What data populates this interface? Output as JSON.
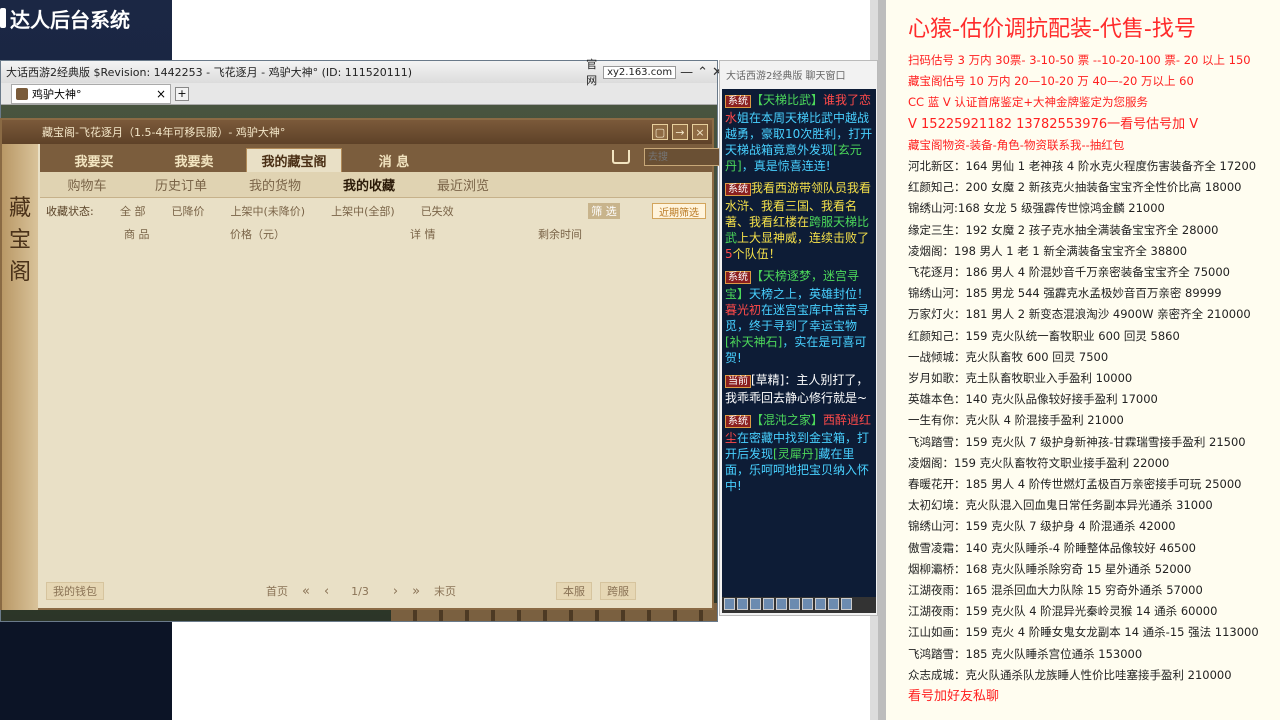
{
  "admin": {
    "title": "达人后台系统"
  },
  "game_window": {
    "title": "大话西游2经典版 $Revision: 1442253 - 飞花逐月 - 鸡驴大神° (ID: 111520111)",
    "official": "官网",
    "site": "xy2.163.com",
    "tab_label": "鸡驴大神°",
    "tab_close": "×",
    "tab_add": "+",
    "btn_min": "—",
    "btn_up": "⌃",
    "btn_close": "✕"
  },
  "dialog": {
    "title": "藏宝阁-飞花逐月（1.5-4年可移民服）- 鸡驴大神°",
    "side_chars": [
      "藏",
      "宝",
      "阁"
    ],
    "main_tabs": [
      "我要买",
      "我要卖",
      "我的藏宝阁",
      "消 息"
    ],
    "search_placeholder": "去搜",
    "sub_tabs": [
      "购物车",
      "历史订单",
      "我的货物",
      "我的收藏",
      "最近浏览"
    ],
    "filter_label": "收藏状态:",
    "filter_opts": [
      "全 部",
      "已降价",
      "上架中(未降价)",
      "上架中(全部)",
      "已失效"
    ],
    "filter_btn": "筛 选",
    "recent_btn": "近期筛选",
    "columns": [
      "商 品",
      "价格（元）",
      "详 情",
      "剩余时间"
    ],
    "footer": {
      "wallet": "我的钱包",
      "first": "首页",
      "page": "1/3",
      "last": "末页",
      "this_server": "本服",
      "cross_server": "跨服"
    }
  },
  "chat": {
    "title": "大话西游2经典版 聊天窗口",
    "messages": [
      {
        "tag": "系统",
        "parts": [
          [
            "c-green",
            "【天梯比武】"
          ],
          [
            "c-red",
            "谁我了恋水"
          ],
          [
            "c-cyan",
            "姐在本周天梯比武中越战越勇，豪取10次胜利，打开天梯战箱竟意外发现"
          ],
          [
            "c-green",
            "[玄元丹]"
          ],
          [
            "c-cyan",
            "，真是惊喜连连!"
          ]
        ]
      },
      {
        "tag": "系统",
        "parts": [
          [
            "c-yellow",
            "我看西游带领队员我看水浒、我看三国、我看名著、我看红楼在"
          ],
          [
            "c-green",
            "跨服天梯比武"
          ],
          [
            "c-yellow",
            "上大显神威，连续击败了"
          ],
          [
            "c-red",
            "5"
          ],
          [
            "c-yellow",
            "个队伍！"
          ]
        ]
      },
      {
        "tag": "系统",
        "parts": [
          [
            "c-green",
            "【天榜逐梦，迷宫寻宝】"
          ],
          [
            "c-cyan",
            "天榜之上，英雄封位！"
          ],
          [
            "c-red",
            "暮光初"
          ],
          [
            "c-cyan",
            "在迷宫宝库中苦苦寻觅，终于寻到了幸运宝物"
          ],
          [
            "c-green",
            "[补天神石]"
          ],
          [
            "c-cyan",
            "，实在是可喜可贺!"
          ]
        ]
      },
      {
        "tag": "当前",
        "parts": [
          [
            "",
            "[草精]："
          ],
          [
            "",
            "主人别打了，我乖乖回去静心修行就是~"
          ]
        ]
      },
      {
        "tag": "系统",
        "parts": [
          [
            "c-green",
            "【混沌之家】"
          ],
          [
            "c-red",
            "西醉逍红尘"
          ],
          [
            "c-cyan",
            "在密藏中找到金宝箱，打开后发现"
          ],
          [
            "c-green",
            "[灵犀丹]"
          ],
          [
            "c-cyan",
            "藏在里面，乐呵呵地把宝贝纳入怀中!"
          ]
        ]
      }
    ]
  },
  "info": {
    "headline": "心猿-估价调抗配装-代售-找号",
    "lines": [
      {
        "cls": "red",
        "text": "扫码估号 3 万内 30票- 3-10-50 票 --10-20-100 票- 20 以上 150"
      },
      {
        "cls": "red",
        "text": "藏宝阁估号 10 万内 20—10-20 万 40—-20 万以上 60"
      },
      {
        "cls": "red",
        "text": "CC 蓝 V 认证首席鉴定+大神金牌鉴定为您服务"
      },
      {
        "cls": "red big",
        "text": "V 15225921182    13782553976一看号估号加 V"
      },
      {
        "cls": "red",
        "text": "藏宝阁物资-装备-角色-物资联系我--抽红包"
      },
      {
        "cls": "",
        "text": "河北新区：164 男仙 1 老神孩 4 阶水克火程度伤害装备齐全 17200"
      },
      {
        "cls": "",
        "text": "红颜知己：200 女魔 2 新孩克火抽装备宝宝齐全性价比高 18000"
      },
      {
        "cls": "",
        "text": "锦绣山河:168 女龙 5 级强霹传世惊鸿金麟 21000"
      },
      {
        "cls": "",
        "text": "缘定三生：192 女魔 2 孩子克水抽全满装备宝宝齐全 28000"
      },
      {
        "cls": "",
        "text": "凌烟阁：198 男人 1 老 1 新全满装备宝宝齐全 38800"
      },
      {
        "cls": "",
        "text": "飞花逐月：186 男人 4 阶混妙音千万亲密装备宝宝齐全 75000"
      },
      {
        "cls": "",
        "text": "锦绣山河：185 男龙 544 强霹克水孟极妙音百万亲密 89999"
      },
      {
        "cls": "",
        "text": "万家灯火：181 男人 2 新变态混浪淘沙 4900W 亲密齐全 210000"
      },
      {
        "cls": "",
        "text": "红颜知己：159 克火队统一畜牧职业 600 回灵 5860"
      },
      {
        "cls": "",
        "text": "一战倾城：克火队畜牧 600 回灵 7500"
      },
      {
        "cls": "",
        "text": "岁月如歌：克土队畜牧职业入手盈利 10000"
      },
      {
        "cls": "",
        "text": "英雄本色：140 克火队品像较好接手盈利 17000"
      },
      {
        "cls": "",
        "text": "一生有你：克火队 4 阶混接手盈利 21000"
      },
      {
        "cls": "",
        "text": "飞鸿踏雪：159 克火队 7 级护身新神孩-甘霖瑞雪接手盈利 21500"
      },
      {
        "cls": "",
        "text": "凌烟阁：159 克火队畜牧符文职业接手盈利 22000"
      },
      {
        "cls": "",
        "text": "春暖花开：185 男人 4 阶传世燃灯孟极百万亲密接手可玩 25000"
      },
      {
        "cls": "",
        "text": "太初幻境：克火队混入回血鬼日常任务副本异光通杀 31000"
      },
      {
        "cls": "",
        "text": "锦绣山河：159 克火队 7 级护身 4 阶混通杀 42000"
      },
      {
        "cls": "",
        "text": "傲雪凌霜：140 克火队睡杀-4 阶睡整体品像较好 46500"
      },
      {
        "cls": "",
        "text": "烟柳灞桥：168 克火队睡杀除穷奇 15 星外通杀 52000"
      },
      {
        "cls": "",
        "text": "江湖夜雨：165 混杀回血大力队除 15 穷奇外通杀 57000"
      },
      {
        "cls": "",
        "text": "江湖夜雨：159 克火队 4 阶混异光秦岭灵猴 14 通杀 60000"
      },
      {
        "cls": "",
        "text": "江山如画：159 克火 4 阶睡女鬼女龙副本 14 通杀-15 强法 113000"
      },
      {
        "cls": "",
        "text": "飞鸿踏雪：185 克火队睡杀宫位通杀 153000"
      },
      {
        "cls": "",
        "text": "众志成城：克火队通杀队龙族睡人性价比哇塞接手盈利 210000"
      },
      {
        "cls": "red big",
        "text": "看号加好友私聊"
      }
    ]
  }
}
